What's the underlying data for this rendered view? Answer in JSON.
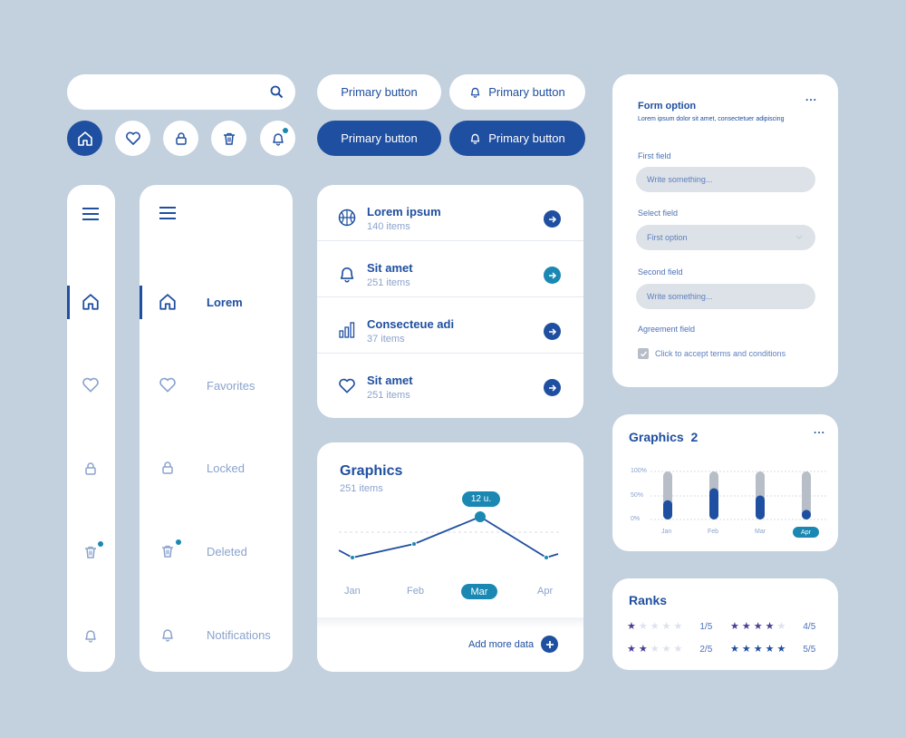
{
  "colors": {
    "background": "#c3d0de",
    "primary": "#1f4fa0",
    "accent": "#1a88b3",
    "muted": "#8aa3cc",
    "field": "#dde2e8"
  },
  "search": {
    "icon": "search-icon"
  },
  "icon_buttons": [
    {
      "name": "home-icon",
      "active": true
    },
    {
      "name": "heart-icon",
      "active": false
    },
    {
      "name": "lock-icon",
      "active": false
    },
    {
      "name": "trash-icon",
      "active": false
    },
    {
      "name": "bell-icon",
      "active": false,
      "notification": true
    }
  ],
  "buttons": {
    "primary_light": "Primary button",
    "primary_light_icon": "Primary button",
    "primary_dark": "Primary button",
    "primary_dark_icon": "Primary button"
  },
  "sidebar_wide": {
    "items": [
      {
        "label": "Lorem",
        "icon": "home-icon",
        "active": true
      },
      {
        "label": "Favorites",
        "icon": "heart-icon",
        "active": false
      },
      {
        "label": "Locked",
        "icon": "lock-icon",
        "active": false
      },
      {
        "label": "Deleted",
        "icon": "trash-icon",
        "active": false,
        "notification": true
      },
      {
        "label": "Notifications",
        "icon": "bell-icon",
        "active": false
      }
    ]
  },
  "list": {
    "items": [
      {
        "title": "Lorem ipsum",
        "subtitle": "140 items",
        "icon": "basketball-icon"
      },
      {
        "title": "Sit amet",
        "subtitle": "251 items",
        "icon": "bell-icon"
      },
      {
        "title": "Consecteue adi",
        "subtitle": "37 items",
        "icon": "bar-chart-icon"
      },
      {
        "title": "Sit amet",
        "subtitle": "251 items",
        "icon": "heart-icon"
      }
    ]
  },
  "graphics": {
    "title": "Graphics",
    "subtitle": "251 items",
    "tooltip": "12 u.",
    "months": [
      "Jan",
      "Feb",
      "Mar",
      "Apr"
    ],
    "selected_month": "Mar",
    "add_label": "Add more data"
  },
  "form": {
    "title": "Form option",
    "subtitle": "Lorem ipsum dolor sit amet, consectetuer adipiscing",
    "menu": "...",
    "first_label": "First field",
    "first_placeholder": "Write something...",
    "select_label": "Select field",
    "select_value": "First option",
    "second_label": "Second field",
    "second_placeholder": "Write something...",
    "agreement_label": "Agreement field",
    "agreement_text": "Click to accept terms and conditions",
    "agreement_checked": true
  },
  "graphics2": {
    "title": "Graphics",
    "title_number": "2",
    "menu": "...",
    "y_ticks": [
      "100%",
      "50%",
      "0%"
    ],
    "months": [
      "Jan",
      "Feb",
      "Mar",
      "Apr"
    ],
    "selected_month": "Apr"
  },
  "ranks": {
    "title": "Ranks",
    "items": [
      {
        "label": "1/5",
        "value": 1
      },
      {
        "label": "4/5",
        "value": 4
      },
      {
        "label": "2/5",
        "value": 2
      },
      {
        "label": "5/5",
        "value": 5
      }
    ]
  },
  "chart_data": [
    {
      "type": "line",
      "title": "Graphics",
      "categories": [
        "Jan",
        "Feb",
        "Mar",
        "Apr"
      ],
      "values": [
        3,
        6,
        12,
        3
      ],
      "annotation": "12 u."
    },
    {
      "type": "bar",
      "title": "Graphics 2",
      "categories": [
        "Jan",
        "Feb",
        "Mar",
        "Apr"
      ],
      "values": [
        40,
        65,
        50,
        20
      ],
      "ylim": [
        0,
        100
      ],
      "y_ticks": [
        "100%",
        "50%",
        "0%"
      ]
    }
  ]
}
